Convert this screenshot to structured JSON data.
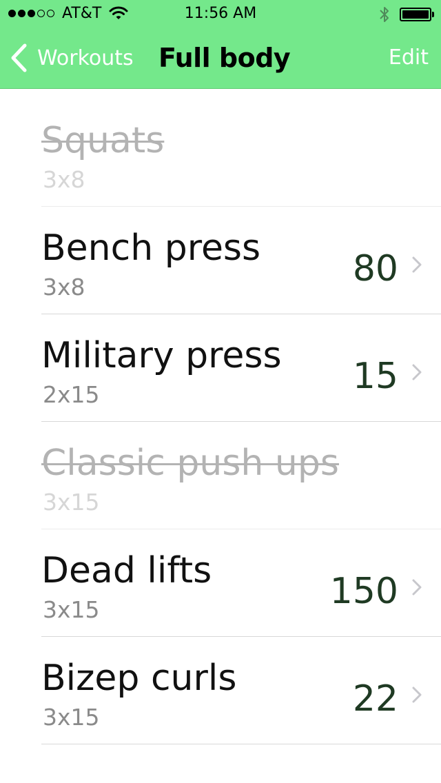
{
  "status_bar": {
    "carrier": "AT&T",
    "time": "11:56 AM",
    "signal_bars_filled": 3,
    "signal_bars_total": 5
  },
  "nav": {
    "back_label": "Workouts",
    "title": "Full body",
    "edit_label": "Edit"
  },
  "exercises": [
    {
      "name": "Squats",
      "sets": "3x8",
      "weight": "",
      "done": true
    },
    {
      "name": "Bench press",
      "sets": "3x8",
      "weight": "80",
      "done": false
    },
    {
      "name": "Military press",
      "sets": "2x15",
      "weight": "15",
      "done": false
    },
    {
      "name": "Classic push ups",
      "sets": "3x15",
      "weight": "",
      "done": true
    },
    {
      "name": "Dead lifts",
      "sets": "3x15",
      "weight": "150",
      "done": false
    },
    {
      "name": "Bizep curls",
      "sets": "3x15",
      "weight": "22",
      "done": false
    }
  ],
  "colors": {
    "nav_background": "#74e88b",
    "weight_text": "#1f3a23",
    "done_text": "#b3b3b3"
  }
}
